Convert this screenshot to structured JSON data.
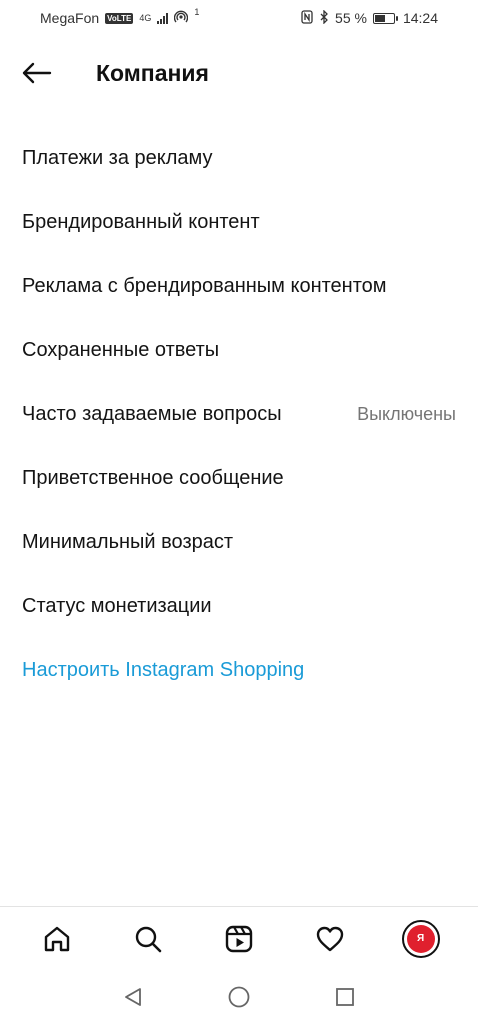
{
  "status_bar": {
    "carrier": "MegaFon",
    "volte": "VoLTE",
    "network": "4G",
    "hotspot_count": "1",
    "battery_percent": "55 %",
    "battery_level": 0.55,
    "time": "14:24"
  },
  "header": {
    "title": "Компания"
  },
  "menu": {
    "items": [
      {
        "label": "Платежи за рекламу",
        "value": ""
      },
      {
        "label": "Брендированный контент",
        "value": ""
      },
      {
        "label": "Реклама с брендированным контентом",
        "value": ""
      },
      {
        "label": "Сохраненные ответы",
        "value": ""
      },
      {
        "label": "Часто задаваемые вопросы",
        "value": "Выключены"
      },
      {
        "label": "Приветственное сообщение",
        "value": ""
      },
      {
        "label": "Минимальный возраст",
        "value": ""
      },
      {
        "label": "Статус монетизации",
        "value": ""
      },
      {
        "label": "Настроить Instagram Shopping",
        "value": ""
      }
    ]
  },
  "bottom_nav": {
    "items": [
      "home-icon",
      "search-icon",
      "reels-icon",
      "heart-icon",
      "profile-avatar"
    ],
    "avatar_text": "Я"
  },
  "colors": {
    "link": "#1a9bd7",
    "text": "#141414",
    "secondary": "#757575",
    "avatar_bg": "#e0202e"
  }
}
